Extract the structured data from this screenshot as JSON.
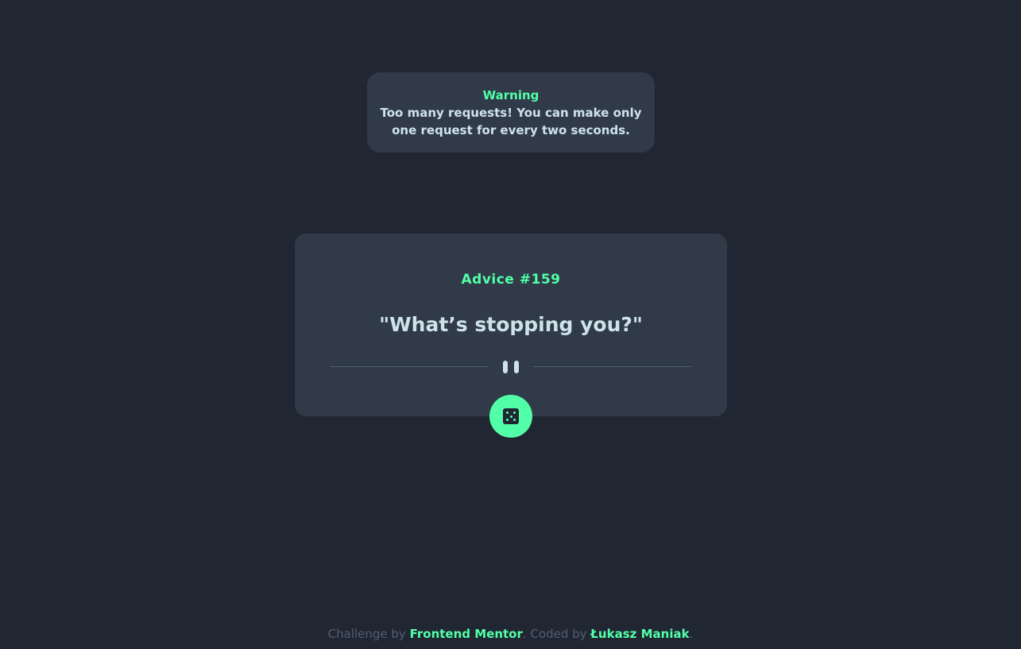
{
  "warning": {
    "title": "Warning",
    "message": "Too many requests! You can make only one request for every two seconds."
  },
  "advice": {
    "id_label": "Advice #159",
    "text": "\"What’s stopping you?\""
  },
  "divider": {
    "icon": "pause-icon"
  },
  "button": {
    "icon": "dice-icon"
  },
  "footer": {
    "prefix": "Challenge by ",
    "challenge_link": "Frontend Mentor",
    "middle": ". Coded by ",
    "author_link": "Łukasz Maniak",
    "suffix": "."
  },
  "colors": {
    "background": "#202632",
    "card": "#313a48",
    "accent": "#52ffa8",
    "text": "#cee3e9",
    "muted": "#545e73"
  }
}
